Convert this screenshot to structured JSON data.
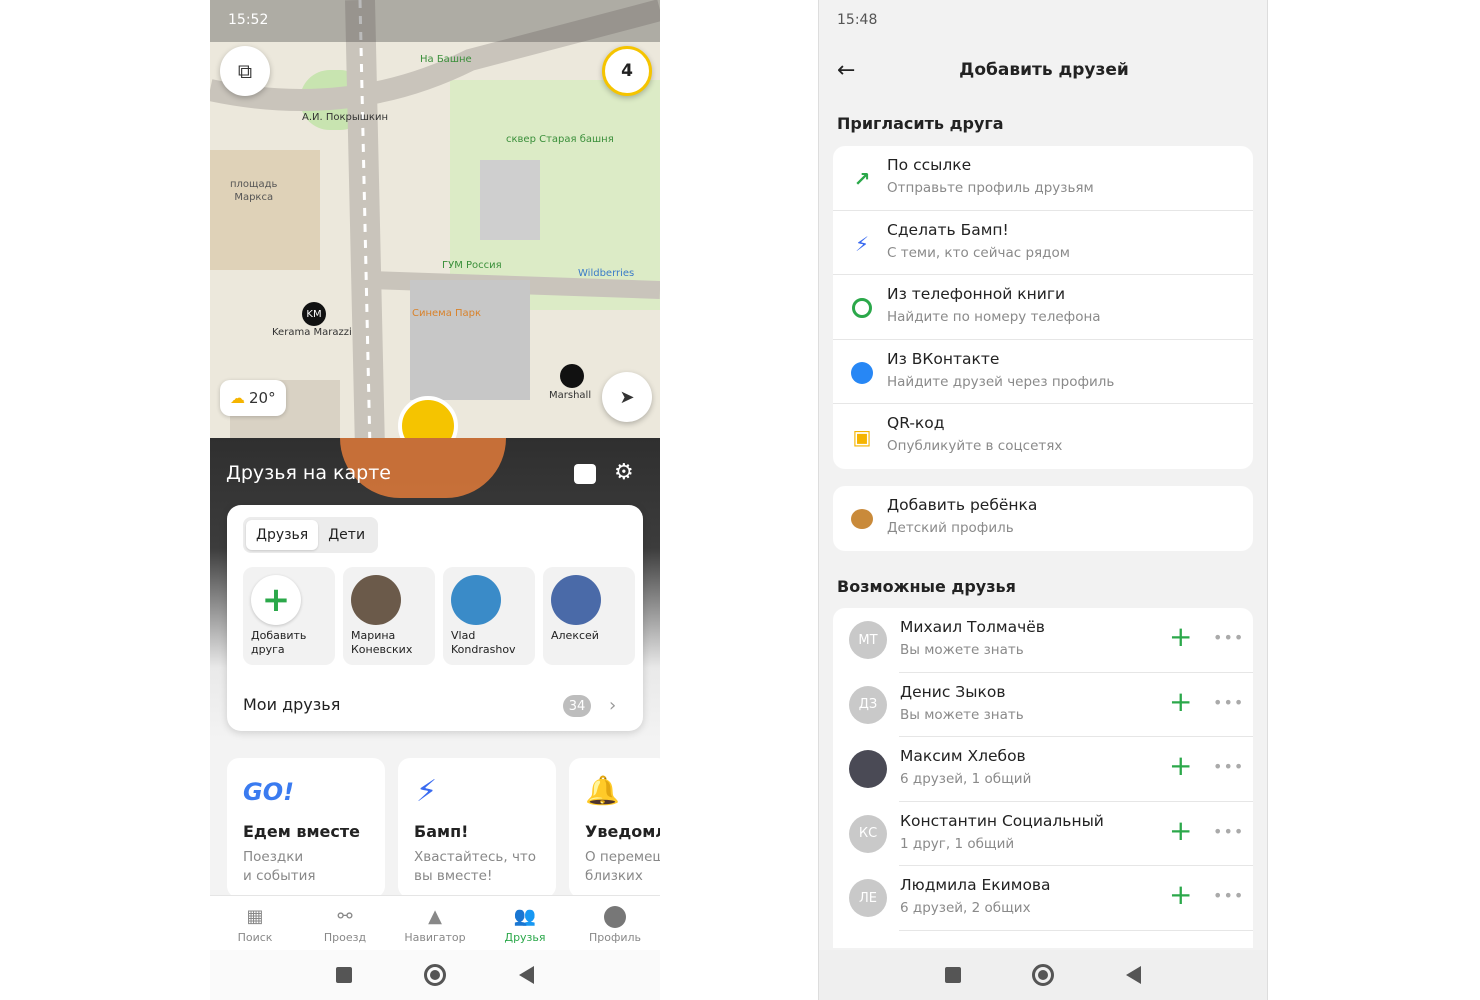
{
  "left": {
    "status": {
      "time": "15:52"
    },
    "map": {
      "layers_label": "layers",
      "badge_count": "4",
      "weather": "20°",
      "labels": {
        "tower": "На Башне",
        "pokryshkin": "А.И. Покрышкин",
        "square": "площадь Маркса",
        "square_line1": "площадь",
        "square_line2": "Маркса",
        "tower_square": "сквер Старая башня",
        "gum": "ГУМ Россия",
        "wildberries": "Wildberries",
        "kerama": "Kerama Marazzi",
        "km": "KM",
        "cinema": "Синема Парк",
        "marshall": "Marshall"
      }
    },
    "panel": {
      "title": "Друзья на карте",
      "seg": [
        "Друзья",
        "Дети"
      ],
      "friends": [
        {
          "line1": "Добавить",
          "line2": "друга"
        },
        {
          "line1": "Марина",
          "line2": "Коневских"
        },
        {
          "line1": "Vlad",
          "line2": "Kondrashov"
        },
        {
          "line1": "",
          "line2": "Алексей"
        }
      ],
      "my_friends": "Мои друзья",
      "my_friends_count": "34"
    },
    "tiles": [
      {
        "title": "Едем вместе",
        "line1": "Поездки",
        "line2": "и события"
      },
      {
        "title": "Бамп!",
        "line1": "Хвастайтесь, что",
        "line2": "вы вместе!"
      },
      {
        "title": "Уведомл",
        "line1": "О перемещ",
        "line2": "близких"
      }
    ],
    "tabs": [
      {
        "label": "Поиск",
        "icon": "grid-icon"
      },
      {
        "label": "Проезд",
        "icon": "transit-icon"
      },
      {
        "label": "Навигатор",
        "icon": "navigator-icon"
      },
      {
        "label": "Друзья",
        "icon": "friends-icon"
      },
      {
        "label": "Профиль",
        "icon": "profile-icon"
      }
    ]
  },
  "right": {
    "status": {
      "time": "15:48"
    },
    "title": "Добавить друзей",
    "invite_header": "Пригласить друга",
    "invite": [
      {
        "title": "По ссылке",
        "sub": "Отправьте профиль друзьям",
        "icon": "link-arrow-icon"
      },
      {
        "title": "Сделать Бамп!",
        "sub": "С теми, кто сейчас рядом",
        "icon": "bump-icon"
      },
      {
        "title": "Из телефонной книги",
        "sub": "Найдите по номеру телефона",
        "icon": "contacts-icon"
      },
      {
        "title": "Из ВКонтакте",
        "sub": "Найдите друзей через профиль",
        "icon": "vk-icon"
      },
      {
        "title": "QR-код",
        "sub": "Опубликуйте в соцсетях",
        "icon": "qr-icon"
      }
    ],
    "child": {
      "title": "Добавить ребёнка",
      "sub": "Детский профиль",
      "icon": "bear-icon"
    },
    "possible_header": "Возможные друзья",
    "possible": [
      {
        "initials": "МТ",
        "name": "Михаил Толмачёв",
        "sub": "Вы можете знать"
      },
      {
        "initials": "ДЗ",
        "name": "Денис Зыков",
        "sub": "Вы можете знать"
      },
      {
        "initials": "",
        "name": "Максим Хлебов",
        "sub": "6 друзей, 1 общий"
      },
      {
        "initials": "КС",
        "name": "Константин Социальный",
        "sub": "1 друг, 1 общий"
      },
      {
        "initials": "ЛЕ",
        "name": "Людмила Екимова",
        "sub": "6 друзей, 2 общих"
      }
    ]
  },
  "colors": {
    "accent": "#2ba84a",
    "badge": "#f5c400"
  }
}
